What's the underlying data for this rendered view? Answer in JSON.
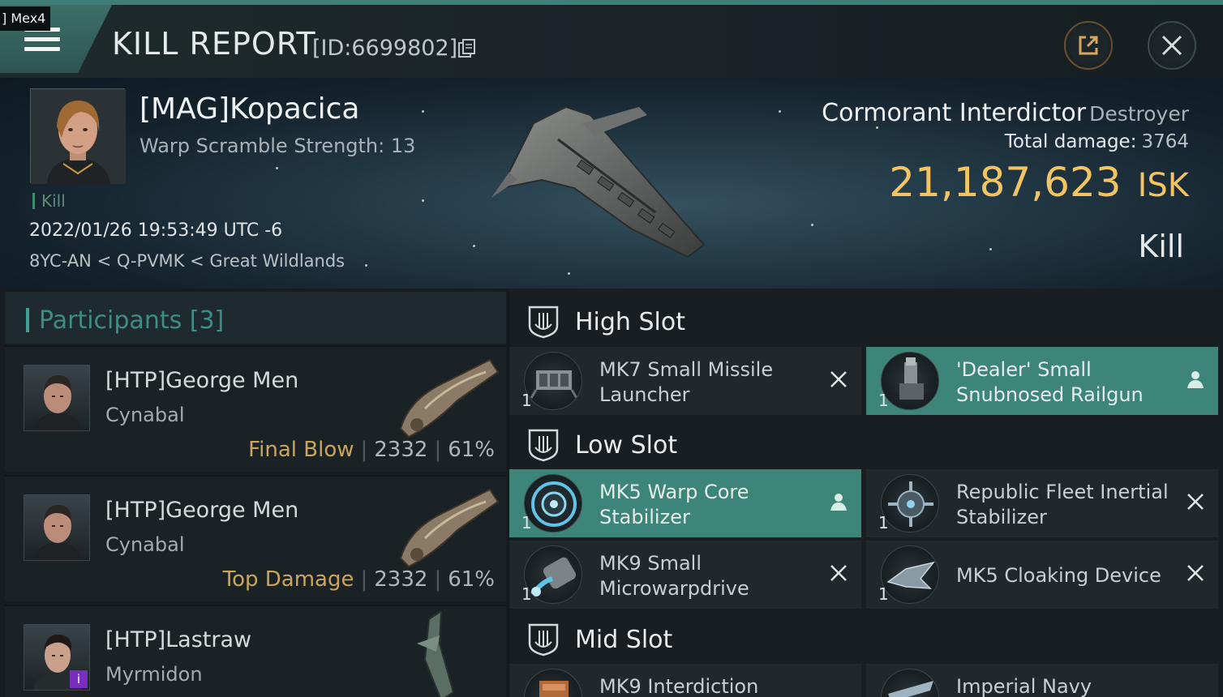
{
  "window": {
    "label": "] Mex4"
  },
  "header": {
    "title": "KILL REPORT",
    "kill_id": "[ID:6699802]",
    "share_icon": "share-external-icon",
    "close_icon": "close-icon"
  },
  "victim": {
    "name": "[MAG]Kopacica",
    "warp_scramble": "Warp Scramble Strength: 13",
    "tag": "Kill",
    "timestamp": "2022/01/26 19:53:49 UTC -6",
    "location": "8YC-AN < Q-PVMK < Great Wildlands",
    "ship_name": "Cormorant Interdictor",
    "ship_class": "Destroyer",
    "total_damage_label": "Total damage:",
    "total_damage_value": "3764",
    "isk_value": "21,187,623",
    "isk_unit": "ISK",
    "result": "Kill"
  },
  "participants": {
    "title": "Participants [3]",
    "rows": [
      {
        "name": "[HTP]George Men",
        "ship": "Cynabal",
        "tag": "Final Blow",
        "damage": "2332",
        "percent": "61%"
      },
      {
        "name": "[HTP]George Men",
        "ship": "Cynabal",
        "tag": "Top Damage",
        "damage": "2332",
        "percent": "61%"
      },
      {
        "name": "[HTP]Lastraw",
        "ship": "Myrmidon",
        "tag": "",
        "damage": "",
        "percent": ""
      }
    ]
  },
  "fittings": {
    "high_slot": {
      "title": "High Slot",
      "items": [
        {
          "name": "MK7 Small Missile Launcher",
          "qty": "1",
          "state": "destroyed",
          "state_icon": "close-icon"
        },
        {
          "name": "'Dealer' Small Snubnosed Railgun",
          "qty": "1",
          "state": "dropped",
          "state_icon": "person-icon"
        }
      ]
    },
    "low_slot": {
      "title": "Low Slot",
      "items": [
        {
          "name": "MK5 Warp Core Stabilizer",
          "qty": "1",
          "state": "dropped",
          "state_icon": "person-icon"
        },
        {
          "name": "Republic Fleet Inertial Stabilizer",
          "qty": "1",
          "state": "destroyed",
          "state_icon": "close-icon"
        },
        {
          "name": "MK9 Small Microwarpdrive",
          "qty": "1",
          "state": "destroyed",
          "state_icon": "close-icon"
        },
        {
          "name": "MK5 Cloaking Device",
          "qty": "1",
          "state": "destroyed",
          "state_icon": "close-icon"
        }
      ]
    },
    "mid_slot": {
      "title": "Mid Slot",
      "items": [
        {
          "name": "MK9 Interdiction",
          "qty": "",
          "state": "destroyed",
          "state_icon": "close-icon"
        },
        {
          "name": "Imperial Navy",
          "qty": "",
          "state": "destroyed",
          "state_icon": "close-icon"
        }
      ]
    }
  },
  "colors": {
    "accent": "#3d8579",
    "isk": "#f2c463",
    "tag": "#c9a65c"
  }
}
